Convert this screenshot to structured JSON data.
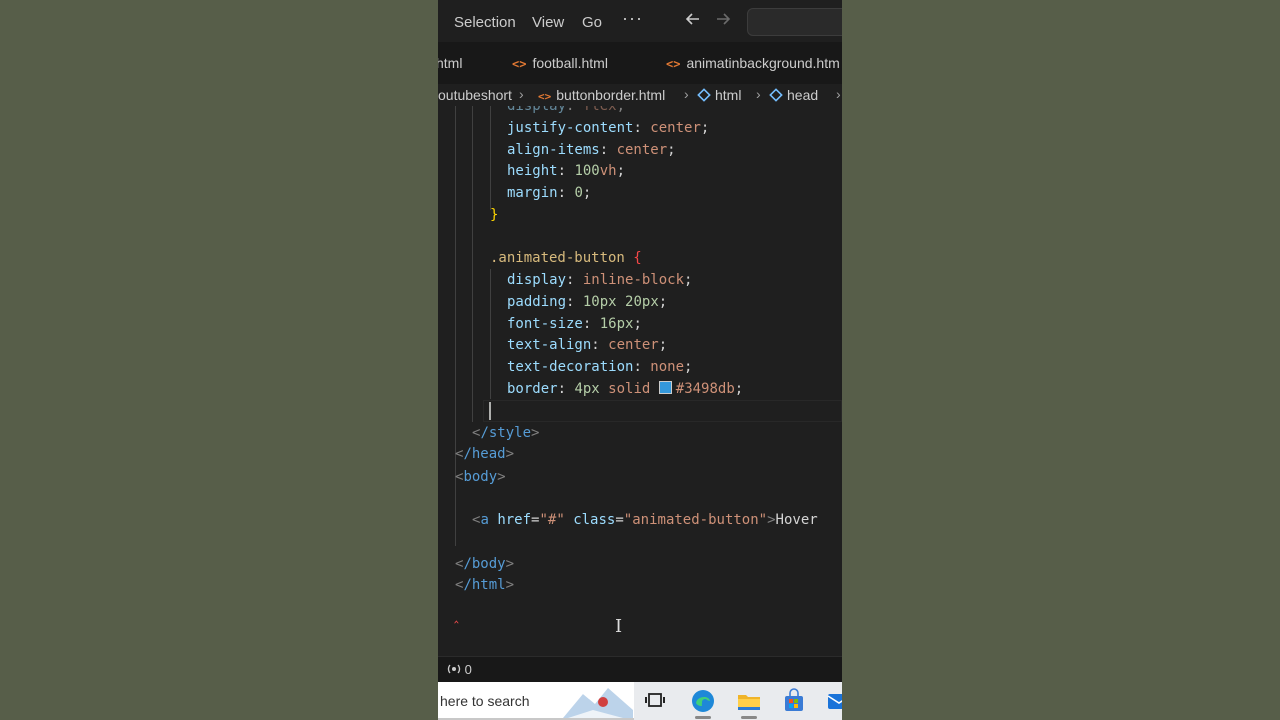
{
  "menu": {
    "selection": "Selection",
    "view": "View",
    "go": "Go",
    "more": "···"
  },
  "nav": {
    "back_icon": "arrow-left-icon",
    "forward_icon": "arrow-right-icon"
  },
  "tabs": [
    {
      "label": "html"
    },
    {
      "label": "football.html"
    },
    {
      "label": "animatinbackground.htm"
    }
  ],
  "breadcrumb": {
    "folder": "outubeshort",
    "file": "buttonborder.html",
    "item1": "html",
    "item2": "head"
  },
  "code": {
    "l0": {
      "prop": "display",
      "val": "flex"
    },
    "l1": {
      "prop": "justify-content",
      "val": "center"
    },
    "l2": {
      "prop": "align-items",
      "val": "center"
    },
    "l3": {
      "prop": "height",
      "num": "100",
      "unit": "vh"
    },
    "l4": {
      "prop": "margin",
      "num": "0"
    },
    "l5": {
      "brace": "}"
    },
    "l6": {
      "selector": ".animated-button",
      "brace": "{"
    },
    "l7": {
      "prop": "display",
      "val": "inline-block"
    },
    "l8": {
      "prop": "padding",
      "num1": "10px",
      "num2": "20px"
    },
    "l9": {
      "prop": "font-size",
      "num": "16px"
    },
    "l10": {
      "prop": "text-align",
      "val": "center"
    },
    "l11": {
      "prop": "text-decoration",
      "val": "none"
    },
    "l12": {
      "prop": "border",
      "num": "4px",
      "val": "solid",
      "color": "#3498db"
    },
    "l13": {
      "tag": "/style"
    },
    "l14": {
      "tag": "/head"
    },
    "l15": {
      "tag": "body"
    },
    "l16": {
      "tag": "a",
      "attr1": "href",
      "val1": "\"#\"",
      "attr2": "class",
      "val2": "\"animated-button\"",
      "text": "Hover"
    },
    "l17": {
      "tag": "/body"
    },
    "l18": {
      "tag": "/html"
    }
  },
  "status": {
    "ports": "0"
  },
  "taskbar": {
    "search_text": "here to search"
  },
  "colors": {
    "accent": "#3498db",
    "html_icon": "#e37933",
    "editor_bg": "#1f1f1f"
  }
}
